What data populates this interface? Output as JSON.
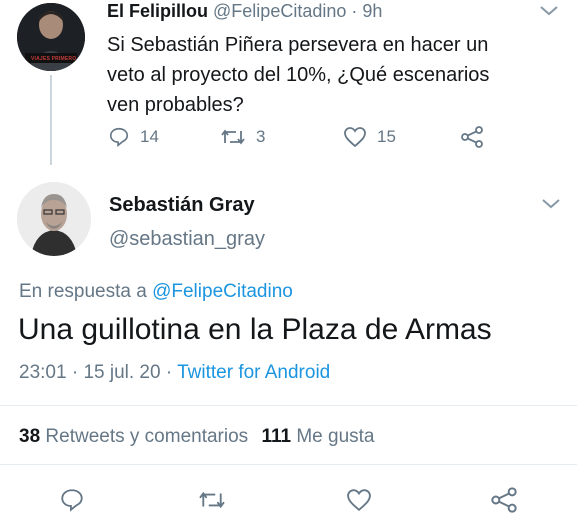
{
  "parent_tweet": {
    "name": "El Felipillou",
    "handle": "@FelipeCitadino",
    "separator": "·",
    "time": "9h",
    "text_line1": "Si Sebastián Piñera persevera en hacer un",
    "text_line2": "veto al proyecto del 10%, ¿Qué escenarios",
    "text_line3": "ven probables?",
    "avatar_caption": "VIAJES PRIMERO",
    "replies": "14",
    "retweets": "3",
    "likes": "15"
  },
  "main_tweet": {
    "name": "Sebastián Gray",
    "handle": "@sebastian_gray",
    "reply_prefix": "En respuesta a",
    "reply_to": "@FelipeCitadino",
    "text": "Una guillotina en la Plaza de Armas",
    "time": "23:01",
    "sep1": "·",
    "date": "15 jul. 20",
    "sep2": "·",
    "source": "Twitter for Android",
    "retweets_count": "38",
    "retweets_label": "Retweets y comentarios",
    "likes_count": "111",
    "likes_label": "Me gusta"
  },
  "icons": {
    "reply": "reply-icon",
    "retweet": "retweet-icon",
    "like": "heart-icon",
    "share": "share-icon",
    "menu": "chevron-down-icon"
  },
  "colors": {
    "link": "#1b95e0",
    "secondary": "#657786",
    "text": "#14171a",
    "divider": "#e6ecf0"
  }
}
